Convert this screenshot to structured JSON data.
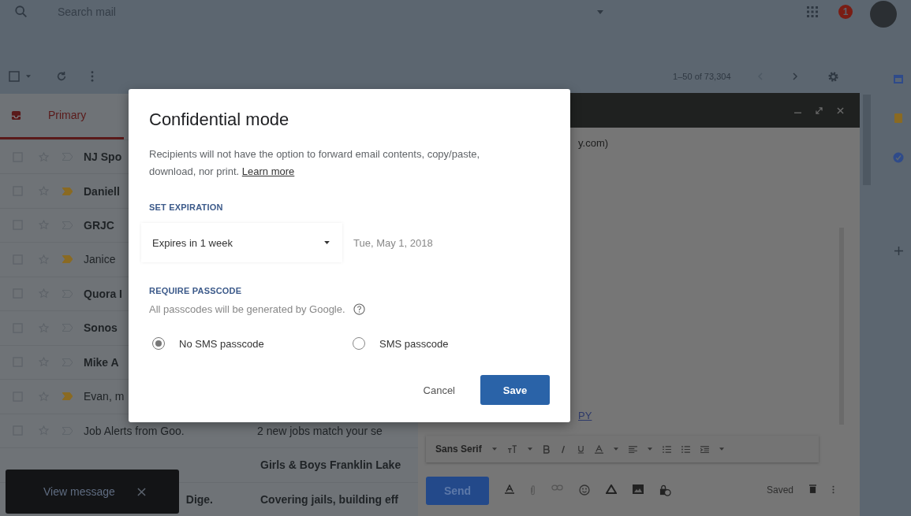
{
  "top_bar": {
    "search_placeholder": "Search mail",
    "notification_count": "1"
  },
  "toolbar": {
    "page_range": "1–50 of 73,304"
  },
  "inbox": {
    "tab": {
      "label": "Primary",
      "selected": true
    },
    "rows": [
      {
        "kind": "full",
        "sender": "NJ Spo",
        "unread": true,
        "important": false
      },
      {
        "kind": "full",
        "sender": "Daniell",
        "unread": true,
        "important": true
      },
      {
        "kind": "full",
        "sender": "GRJC",
        "unread": true,
        "important": false
      },
      {
        "kind": "full",
        "sender": "Janice",
        "unread": false,
        "important": true
      },
      {
        "kind": "full",
        "sender": "Quora I",
        "unread": true,
        "important": false
      },
      {
        "kind": "full",
        "sender": "Sonos",
        "unread": true,
        "important": false
      },
      {
        "kind": "full",
        "sender": "Mike A",
        "unread": true,
        "important": false
      },
      {
        "kind": "full",
        "sender": "Evan, m",
        "unread": false,
        "important": true
      },
      {
        "kind": "full",
        "sender": "Job Alerts from Goo.",
        "subject": "2 new jobs match your se",
        "unread": false,
        "important": false
      },
      {
        "kind": "partial",
        "subject": "Girls & Boys Franklin Lake",
        "unread": true
      },
      {
        "kind": "partial",
        "sender_tail": "Dige.",
        "subject": "Covering jails, building eff",
        "unread": true
      }
    ]
  },
  "compose": {
    "recipient_fragment": "y.com)",
    "link_fragment": "PY",
    "font": "Sans Serif",
    "send": "Send",
    "status": "Saved"
  },
  "snackbar": {
    "action": "View message"
  },
  "dialog": {
    "title": "Confidential mode",
    "description": "Recipients will not have the option to forward email contents, copy/paste, download, nor print.",
    "learn_more": "Learn more",
    "expiration": {
      "heading": "SET EXPIRATION",
      "value": "Expires in 1 week",
      "date": "Tue, May 1, 2018"
    },
    "passcode": {
      "heading": "REQUIRE PASSCODE",
      "hint": "All passcodes will be generated by Google.",
      "options": [
        {
          "label": "No SMS passcode",
          "selected": true
        },
        {
          "label": "SMS passcode",
          "selected": false
        }
      ]
    },
    "buttons": {
      "cancel": "Cancel",
      "save": "Save"
    }
  }
}
